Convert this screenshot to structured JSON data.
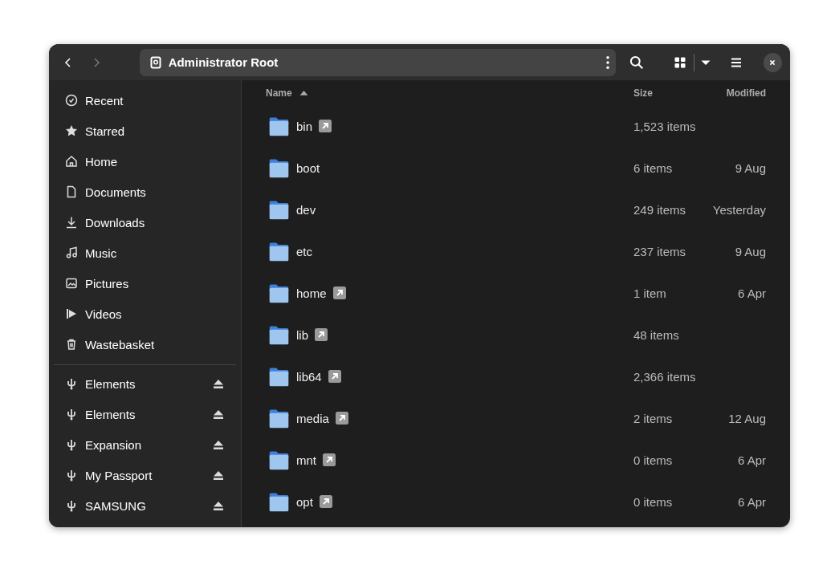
{
  "header": {
    "back": {
      "disabled": false
    },
    "forward": {
      "disabled": true
    },
    "location": "Administrator Root"
  },
  "sidebar": {
    "places": [
      {
        "label": "Recent"
      },
      {
        "label": "Starred"
      },
      {
        "label": "Home"
      },
      {
        "label": "Documents"
      },
      {
        "label": "Downloads"
      },
      {
        "label": "Music"
      },
      {
        "label": "Pictures"
      },
      {
        "label": "Videos"
      },
      {
        "label": "Wastebasket"
      }
    ],
    "devices": [
      {
        "label": "Elements",
        "ejectable": true
      },
      {
        "label": "Elements",
        "ejectable": true
      },
      {
        "label": "Expansion",
        "ejectable": true
      },
      {
        "label": "My Passport",
        "ejectable": true
      },
      {
        "label": "SAMSUNG",
        "ejectable": true
      }
    ]
  },
  "table": {
    "columns": [
      {
        "label": "Name",
        "sorted": true
      },
      {
        "label": "Size",
        "sorted": false
      },
      {
        "label": "Modified",
        "sorted": false
      }
    ],
    "rows": [
      {
        "name": "bin",
        "symlink": true,
        "size": "1,523 items",
        "modified": ""
      },
      {
        "name": "boot",
        "symlink": false,
        "size": "6 items",
        "modified": "9 Aug"
      },
      {
        "name": "dev",
        "symlink": false,
        "size": "249 items",
        "modified": "Yesterday"
      },
      {
        "name": "etc",
        "symlink": false,
        "size": "237 items",
        "modified": "9 Aug"
      },
      {
        "name": "home",
        "symlink": true,
        "size": "1 item",
        "modified": "6 Apr"
      },
      {
        "name": "lib",
        "symlink": true,
        "size": "48 items",
        "modified": ""
      },
      {
        "name": "lib64",
        "symlink": true,
        "size": "2,366 items",
        "modified": ""
      },
      {
        "name": "media",
        "symlink": true,
        "size": "2 items",
        "modified": "12 Aug"
      },
      {
        "name": "mnt",
        "symlink": true,
        "size": "0 items",
        "modified": "6 Apr"
      },
      {
        "name": "opt",
        "symlink": true,
        "size": "0 items",
        "modified": "6 Apr"
      }
    ]
  }
}
